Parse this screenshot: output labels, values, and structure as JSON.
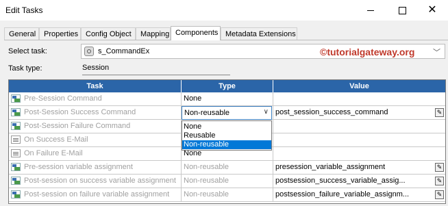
{
  "window": {
    "title": "Edit Tasks"
  },
  "tabs": [
    {
      "label": "General",
      "active": false
    },
    {
      "label": "Properties",
      "active": false
    },
    {
      "label": "Config Object",
      "active": false
    },
    {
      "label": "Mapping",
      "active": false
    },
    {
      "label": "Components",
      "active": true
    },
    {
      "label": "Metadata Extensions",
      "active": false
    }
  ],
  "select_task": {
    "label": "Select task:",
    "value": "s_CommandEx",
    "watermark": "©tutorialgateway.org"
  },
  "task_type": {
    "label": "Task type:",
    "value": "Session"
  },
  "grid": {
    "headers": {
      "task": "Task",
      "type": "Type",
      "value": "Value"
    },
    "header_color": "#2b65a8",
    "rows": [
      {
        "task": "Pre-Session Command",
        "type": "None",
        "value": "",
        "icon": "command-icon"
      },
      {
        "task": "Post-Session Success Command",
        "type": "Non-reusable",
        "value": "post_session_success_command",
        "icon": "command-icon"
      },
      {
        "task": "Post-Session Failure Command",
        "type": "",
        "value": "",
        "icon": "command-icon"
      },
      {
        "task": "On Success E-Mail",
        "type": "",
        "value": "",
        "icon": "email-icon"
      },
      {
        "task": "On Failure E-Mail",
        "type": "None",
        "value": "",
        "icon": "email-icon"
      },
      {
        "task": "Pre-session variable assignment",
        "type": "Non-reusable",
        "value": "presession_variable_assignment",
        "icon": "command-icon"
      },
      {
        "task": "Post-session on success variable assignment",
        "type": "Non-reusable",
        "value": "postsession_success_variable_assig...",
        "icon": "command-icon"
      },
      {
        "task": "Post-session on failure variable assignment",
        "type": "Non-reusable",
        "value": "postsession_failure_variable_assignm...",
        "icon": "command-icon"
      }
    ]
  },
  "type_dropdown": {
    "selected": "Non-reusable",
    "options": [
      "None",
      "Reusable",
      "Non-reusable"
    ],
    "highlight_color": "#0078d7"
  }
}
